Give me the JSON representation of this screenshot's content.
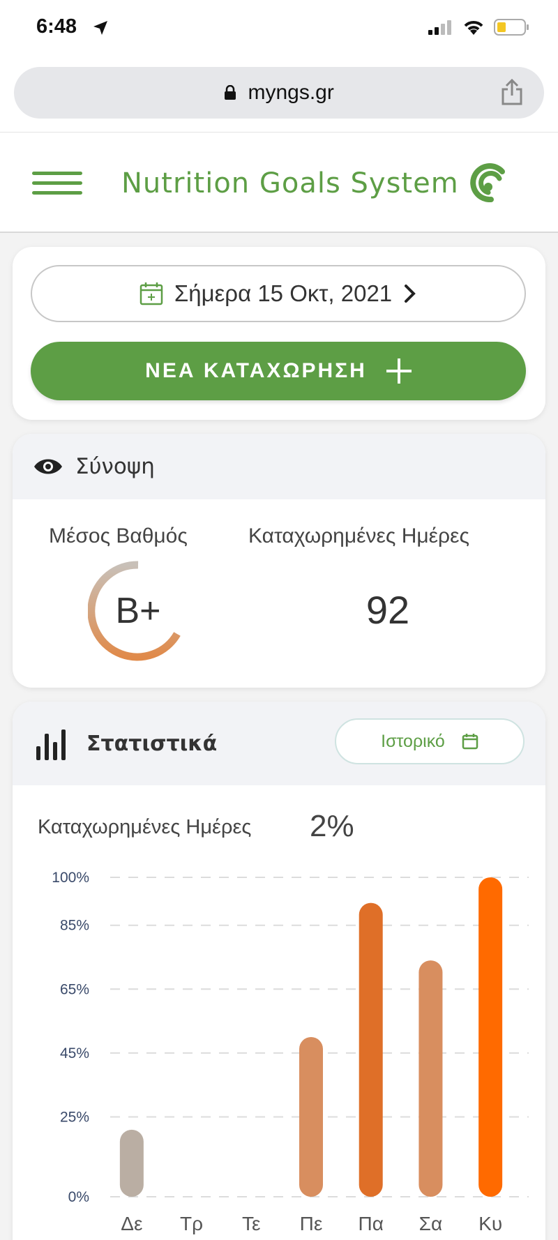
{
  "status_bar": {
    "time": "6:48"
  },
  "browser": {
    "url": "myngs.gr"
  },
  "header": {
    "title": "Nutrition Goals System"
  },
  "date_selector": {
    "label": "Σήμερα 15 Οκτ, 2021"
  },
  "new_entry": {
    "label": "ΝΕΑ ΚΑΤΑΧΩΡΗΣΗ"
  },
  "summary": {
    "title": "Σύνοψη",
    "avg_label": "Μέσος Βαθμός",
    "avg_value": "B+",
    "days_label": "Καταχωρημένες Ημέρες",
    "days_value": "92"
  },
  "statistics": {
    "title": "Στατιστικά",
    "history_label": "Ιστορικό",
    "subtitle": "Καταχωρημένες Ημέρες",
    "percentage": "2%"
  },
  "colors": {
    "brand_green": "#5d9e45",
    "bar_colors": [
      "#baaea3",
      "#baaea3",
      "#baaea3",
      "#d88e5f",
      "#df6f28",
      "#d88e5f",
      "#ff6a00"
    ]
  },
  "icons": [
    "location-arrow-icon",
    "signal-icon",
    "wifi-icon",
    "battery-icon",
    "lock-icon",
    "share-icon",
    "menu-icon",
    "logo-icon",
    "calendar-icon",
    "chevron-right-icon",
    "plus-icon",
    "eye-icon",
    "bar-chart-icon"
  ],
  "chart_data": {
    "type": "bar",
    "categories": [
      "Δε",
      "Τρ",
      "Τε",
      "Πε",
      "Πα",
      "Σα",
      "Κυ"
    ],
    "values": [
      21,
      0,
      0,
      50,
      92,
      74,
      100
    ],
    "ytick_values": [
      0,
      25,
      45,
      65,
      85,
      100
    ],
    "ytick_labels": [
      "0%",
      "25%",
      "45%",
      "65%",
      "85%",
      "100%"
    ],
    "ylim": [
      0,
      100
    ],
    "grid": true,
    "xlabel": "",
    "ylabel": ""
  }
}
